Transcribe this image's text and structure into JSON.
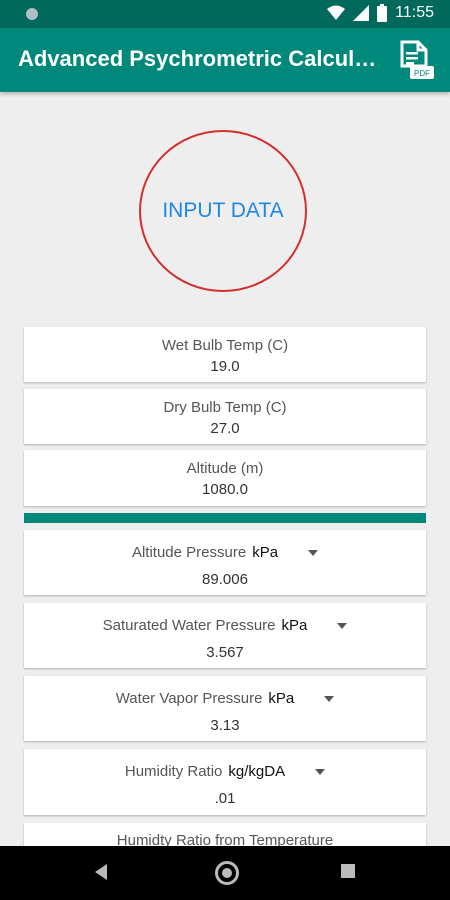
{
  "status": {
    "time": "11:55"
  },
  "appbar": {
    "title": "Advanced Psychrometric Calcula…",
    "pdf_icon": "pdf-document-icon"
  },
  "circle_button": {
    "label": "INPUT DATA"
  },
  "inputs": [
    {
      "label": "Wet Bulb Temp (C)",
      "value": "19.0"
    },
    {
      "label": "Dry Bulb Temp (C)",
      "value": "27.0"
    },
    {
      "label": "Altitude (m)",
      "value": "1080.0"
    }
  ],
  "results": [
    {
      "label": "Altitude Pressure",
      "unit": "kPa",
      "value": "89.006"
    },
    {
      "label": "Saturated Water Pressure",
      "unit": "kPa",
      "value": "3.567"
    },
    {
      "label": "Water Vapor Pressure",
      "unit": "kPa",
      "value": "3.13"
    },
    {
      "label": "Humidity Ratio",
      "unit": "kg/kgDA",
      "value": ".01"
    },
    {
      "label": "Humidty Ratio from Temperature"
    }
  ],
  "colors": {
    "primary": "#00897b",
    "primary_dark": "#00695c",
    "accent_circle": "#d32f2f",
    "button_text": "#1e88e5"
  }
}
